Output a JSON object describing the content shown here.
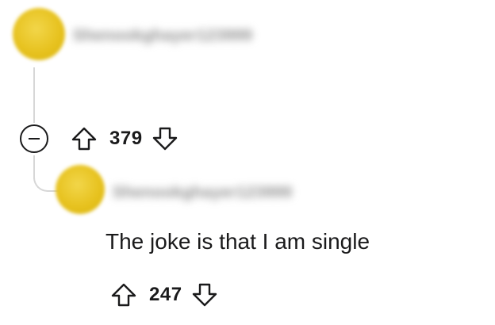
{
  "parent_comment": {
    "username": "Shenookghayer123999",
    "votes": "379"
  },
  "reply_comment": {
    "username": "Shenookghayer123999",
    "body": "The joke is that I am single",
    "votes": "247"
  },
  "icons": {
    "collapse": "collapse-minus-icon",
    "upvote": "upvote-arrow-icon",
    "downvote": "downvote-arrow-icon"
  },
  "colors": {
    "avatar": "#e7c21f",
    "thread_line": "#d7d7d7",
    "text": "#1a1a1b"
  }
}
